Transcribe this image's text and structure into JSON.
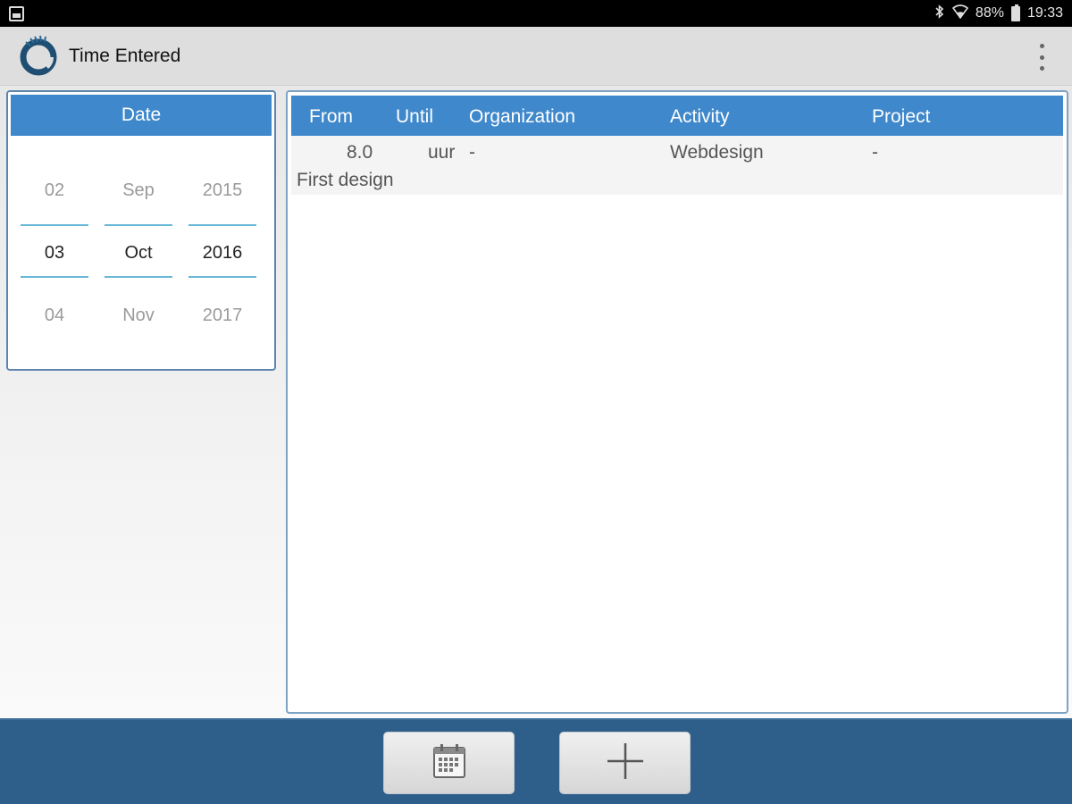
{
  "status_bar": {
    "battery": "88%",
    "time": "19:33",
    "icons": [
      "notification-icon",
      "bluetooth-icon",
      "wifi-icon",
      "battery-icon"
    ]
  },
  "app_bar": {
    "title": "Time Entered",
    "logo_icon": "app-logo-icon",
    "menu_icon": "overflow-menu-icon"
  },
  "date_panel": {
    "header": "Date",
    "columns": [
      {
        "prev": "02",
        "selected": "03",
        "next": "04"
      },
      {
        "prev": "Sep",
        "selected": "Oct",
        "next": "Nov"
      },
      {
        "prev": "2015",
        "selected": "2016",
        "next": "2017"
      }
    ]
  },
  "table": {
    "headers": [
      "From",
      "Until",
      "Organization",
      "Activity",
      "Project"
    ],
    "rows": [
      {
        "hours": "8.0",
        "unit": "uur",
        "organization": "-",
        "activity": "Webdesign",
        "project": "-",
        "description": "First design"
      }
    ]
  },
  "bottom_bar": {
    "buttons": [
      {
        "icon": "calendar-icon"
      },
      {
        "icon": "plus-icon"
      }
    ]
  },
  "colors": {
    "accent": "#3f88cb",
    "bottom_bar": "#2e5e8a",
    "picker_line": "#69b8d8"
  }
}
